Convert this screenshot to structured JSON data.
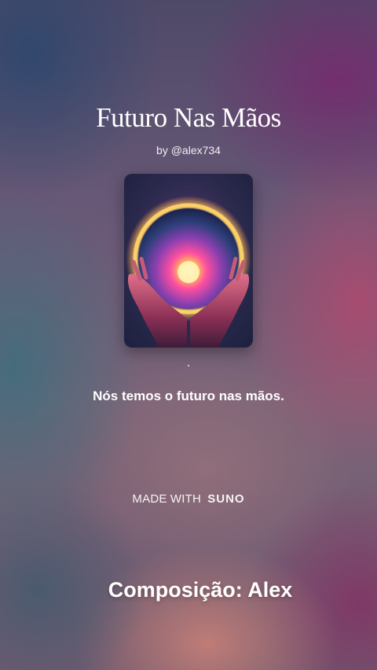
{
  "song": {
    "title": "Futuro Nas Mãos",
    "byline": "by @alex734"
  },
  "cover": {
    "icon": "glowing-orb-hands-artwork"
  },
  "lyric": {
    "current_line": "Nós temos o futuro nas mãos."
  },
  "branding": {
    "made_with": "MADE WITH",
    "brand": "SUNO"
  },
  "overlay": {
    "caption": "Composição: Alex"
  },
  "colors": {
    "text": "#ffffff",
    "background_top": "#4f4968",
    "background_bottom": "#6e5a70"
  }
}
